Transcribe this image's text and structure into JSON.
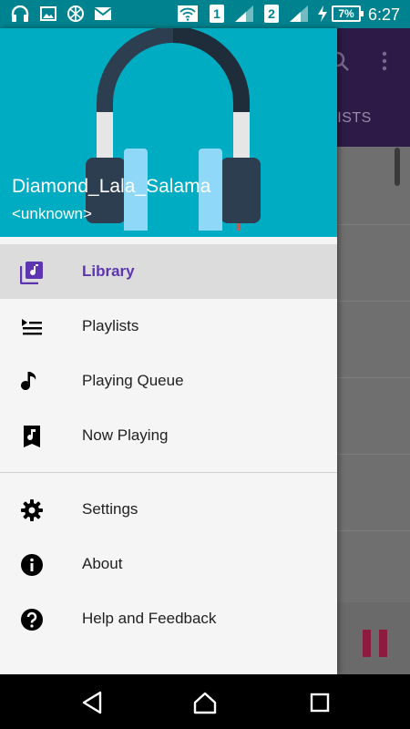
{
  "status_bar": {
    "icons": [
      "headset-icon",
      "gallery-icon",
      "vpn-icon",
      "mail-icon",
      "wifi-icon",
      "signal-icon",
      "charging-icon"
    ],
    "sim1_label": "1",
    "sim2_label": "2",
    "battery_text": "7%",
    "time": "6:27"
  },
  "background_app": {
    "tab_label": "TISTS",
    "toolbar_color": "#2e1a47",
    "pause_color": "#8e1b3d"
  },
  "drawer": {
    "header": {
      "background": "#00acc1",
      "track_title": "Diamond_Lala_Salama",
      "artist": "<unknown>",
      "art_icon": "headphones-art"
    },
    "items": [
      {
        "label": "Library",
        "icon": "library-music-icon",
        "active": true
      },
      {
        "label": "Playlists",
        "icon": "playlist-icon",
        "active": false
      },
      {
        "label": "Playing Queue",
        "icon": "music-note-icon",
        "active": false
      },
      {
        "label": "Now Playing",
        "icon": "now-playing-icon",
        "active": false
      }
    ],
    "secondary_items": [
      {
        "label": "Settings",
        "icon": "gear-icon"
      },
      {
        "label": "About",
        "icon": "info-icon"
      },
      {
        "label": "Help and Feedback",
        "icon": "help-icon"
      }
    ],
    "accent_color": "#5e35b1"
  },
  "nav_bar": {
    "buttons": [
      "back-icon",
      "home-icon",
      "recents-icon"
    ]
  }
}
